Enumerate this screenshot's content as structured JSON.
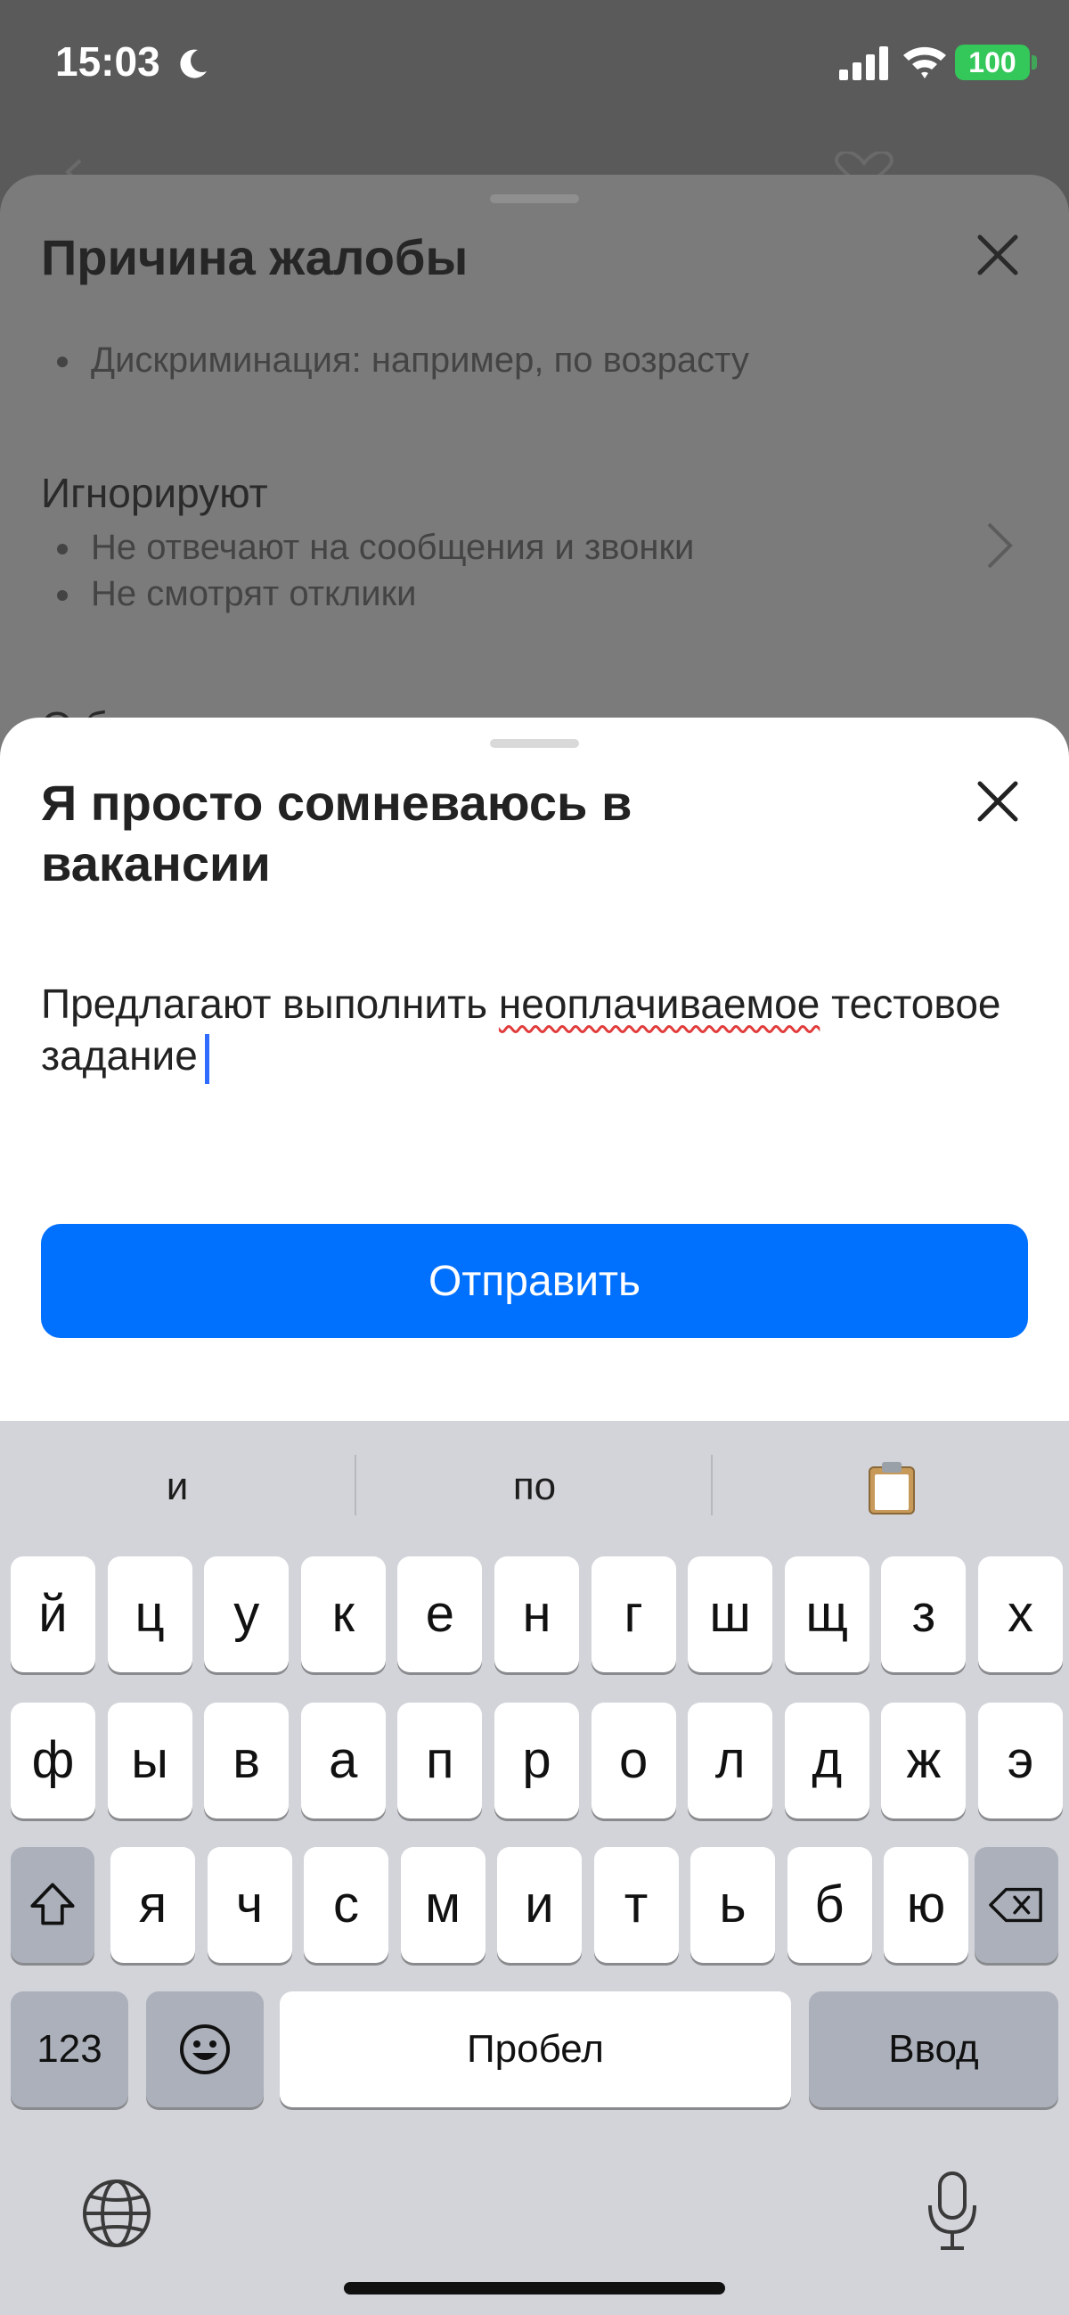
{
  "status_bar": {
    "time": "15:03",
    "battery": "100"
  },
  "icons": {
    "moon": "moon-icon",
    "signal": "signal-icon",
    "wifi": "wifi-icon",
    "close": "close-icon",
    "chevron": "chevron-right-icon",
    "heart": "heart-icon",
    "back": "back-arrow-icon",
    "clipboard": "clipboard-icon",
    "globe": "globe-icon",
    "mic": "microphone-icon",
    "shift": "shift-icon",
    "backspace": "backspace-icon",
    "emoji": "emoji-icon"
  },
  "colors": {
    "accent": "#0070ff",
    "battery": "#34c759",
    "caret": "#2f6bff",
    "spellcheck": "#e23b3b"
  },
  "complaint_sheet": {
    "title": "Причина жалобы",
    "clipped_text": ". . , .",
    "prev_bullet": "Дискриминация: например, по возрасту",
    "option": {
      "title": "Игнорируют",
      "bullets": [
        "Не отвечают на сообщения и звонки",
        "Не смотрят отклики"
      ]
    },
    "next_option_partial": "О            б"
  },
  "doubt_sheet": {
    "title": "Я просто сомневаюсь в вакансии",
    "input_text_before": "Предлагают выполнить ",
    "input_text_misspelled": "неоплачиваемое",
    "input_text_after": " тестовое задание",
    "submit_label": "Отправить"
  },
  "keyboard": {
    "suggestions": [
      "и",
      "по"
    ],
    "row1": [
      "й",
      "ц",
      "у",
      "к",
      "е",
      "н",
      "г",
      "ш",
      "щ",
      "з",
      "х"
    ],
    "row2": [
      "ф",
      "ы",
      "в",
      "а",
      "п",
      "р",
      "о",
      "л",
      "д",
      "ж",
      "э"
    ],
    "row3": [
      "я",
      "ч",
      "с",
      "м",
      "и",
      "т",
      "ь",
      "б",
      "ю"
    ],
    "numbers_label": "123",
    "space_label": "Пробел",
    "return_label": "Ввод"
  }
}
